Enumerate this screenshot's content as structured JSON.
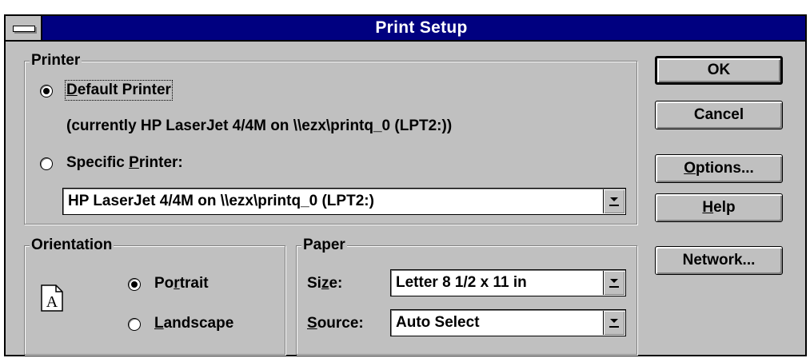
{
  "window": {
    "title": "Print Setup"
  },
  "printer_group": {
    "legend": "Printer",
    "default_radio": {
      "pre": "",
      "mnemonic": "D",
      "post": "efault Printer",
      "selected": true
    },
    "current_printer_text": "(currently HP LaserJet 4/4M on \\\\ezx\\printq_0 (LPT2:))",
    "specific_radio": {
      "pre": "Specific ",
      "mnemonic": "P",
      "post": "rinter:",
      "selected": false
    },
    "printer_combo_value": "HP LaserJet 4/4M on \\\\ezx\\printq_0 (LPT2:)"
  },
  "orientation_group": {
    "legend": "Orientation",
    "icon_letter": "A",
    "portrait": {
      "pre": "Po",
      "mnemonic": "r",
      "post": "trait",
      "selected": true
    },
    "landscape": {
      "pre": "",
      "mnemonic": "L",
      "post": "andscape",
      "selected": false
    }
  },
  "paper_group": {
    "legend": "Paper",
    "size_label": {
      "pre": "Si",
      "mnemonic": "z",
      "post": "e:"
    },
    "size_value": "Letter 8 1/2 x 11 in",
    "source_label": {
      "pre": "",
      "mnemonic": "S",
      "post": "ource:"
    },
    "source_value": "Auto Select"
  },
  "buttons": {
    "ok": "OK",
    "cancel": "Cancel",
    "options": {
      "pre": "",
      "mnemonic": "O",
      "post": "ptions..."
    },
    "help": {
      "pre": "",
      "mnemonic": "H",
      "post": "elp"
    },
    "network": "Network..."
  },
  "colors": {
    "title_bar": "#000080",
    "face": "#c0c0c0",
    "shadow": "#808080",
    "highlight": "#ffffff"
  }
}
